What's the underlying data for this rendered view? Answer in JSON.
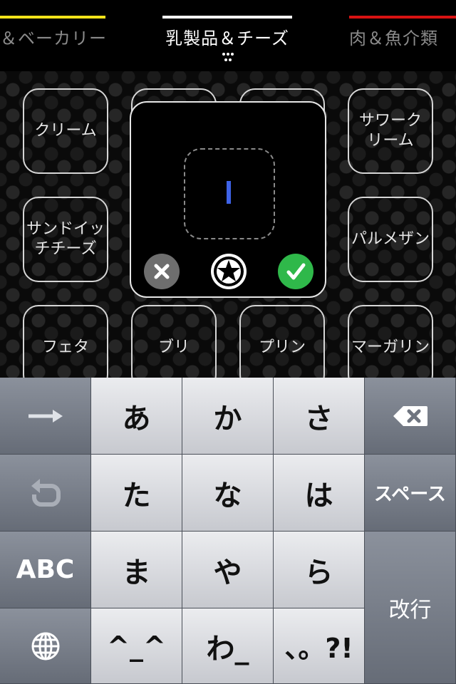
{
  "tabs": {
    "left": {
      "label": "＆ベーカリー",
      "color": "#f2e21a"
    },
    "center": {
      "label": "乳製品＆チーズ",
      "color": "#ffffff"
    },
    "right": {
      "label": "肉＆魚介類",
      "color": "#d81212"
    },
    "more_icon": "ellipsis-icon"
  },
  "items": [
    {
      "label": "クリーム"
    },
    {
      "label": "サワークリーム"
    },
    {
      "label": "サンドイッチチーズ"
    },
    {
      "label": "パルメザン"
    },
    {
      "label": "フェタ"
    },
    {
      "label": "ブリ"
    },
    {
      "label": "プリン"
    },
    {
      "label": "マーガリン"
    }
  ],
  "popup": {
    "input_value": "",
    "cancel_icon": "close-icon",
    "favorite_icon": "star-icon",
    "confirm_icon": "checkmark-icon",
    "colors": {
      "caret": "#3e63e8",
      "confirm": "#2fb84a",
      "cancel": "#6e6e6e"
    }
  },
  "keyboard": {
    "next_icon": "arrow-right-icon",
    "undo_icon": "undo-icon",
    "delete_icon": "backspace-icon",
    "globe_icon": "globe-icon",
    "abc": "ABC",
    "space": "スペース",
    "enter": "改行",
    "keys": [
      "あ",
      "か",
      "さ",
      "た",
      "な",
      "は",
      "ま",
      "や",
      "ら",
      "^_^",
      "わ_",
      "、。?!"
    ]
  }
}
